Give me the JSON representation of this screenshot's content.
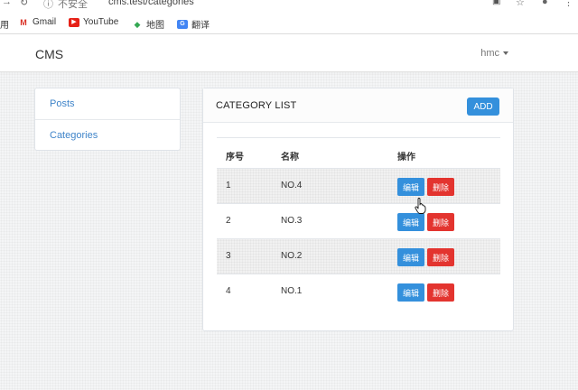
{
  "browser": {
    "security_label": "不安全",
    "url": "cms.test/categories",
    "bookmarks": [
      {
        "label": "用",
        "icon": "apps-icon"
      },
      {
        "label": "Gmail",
        "icon": "gmail-icon"
      },
      {
        "label": "YouTube",
        "icon": "youtube-icon"
      },
      {
        "label": "地图",
        "icon": "maps-icon"
      },
      {
        "label": "翻译",
        "icon": "translate-icon"
      }
    ]
  },
  "navbar": {
    "brand": "CMS",
    "user": "hmc"
  },
  "sidebar": {
    "items": [
      {
        "label": "Posts"
      },
      {
        "label": "Categories"
      }
    ]
  },
  "card": {
    "title": "CATEGORY LIST",
    "add_label": "ADD"
  },
  "table": {
    "headers": [
      "序号",
      "名称",
      "操作"
    ],
    "edit_label": "编辑",
    "delete_label": "删除",
    "rows": [
      {
        "id": "1",
        "name": "NO.4"
      },
      {
        "id": "2",
        "name": "NO.3"
      },
      {
        "id": "3",
        "name": "NO.2"
      },
      {
        "id": "4",
        "name": "NO.1"
      }
    ]
  },
  "colors": {
    "primary": "#3490dc",
    "danger": "#e3342f",
    "link": "#3f84c9"
  }
}
